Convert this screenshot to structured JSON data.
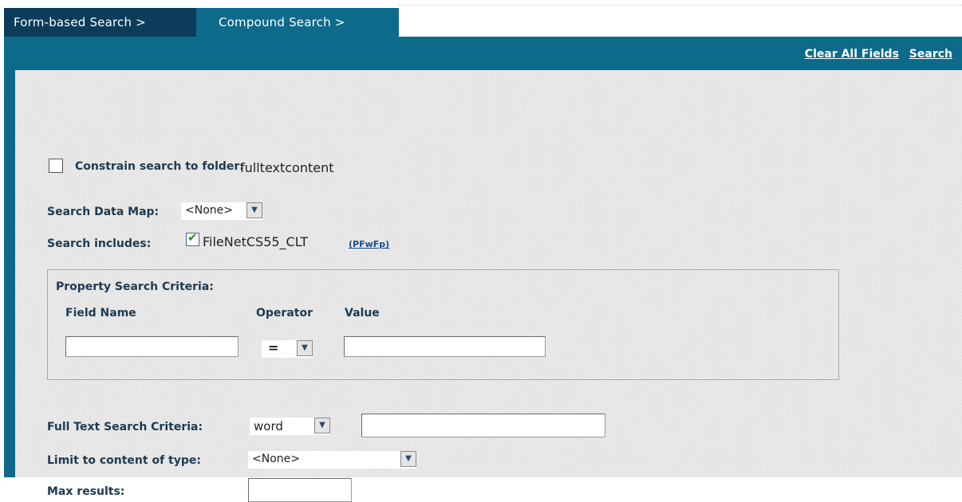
{
  "tabs": {
    "form_based": "Form-based Search >",
    "compound": "Compound Search >"
  },
  "header_links": {
    "clear_all": "Clear All Fields",
    "search": "Search"
  },
  "constrain": {
    "label": "Constrain search to folder:",
    "folder": "fulltextcontent",
    "checked": false
  },
  "data_map": {
    "label": "Search Data Map:",
    "selected": "<None>"
  },
  "includes": {
    "label": "Search includes:",
    "store": "FileNetCS55_CLT",
    "link": "(PFwFp)",
    "checked": true
  },
  "property_criteria": {
    "title": "Property Search Criteria:",
    "col_field": "Field Name",
    "col_operator": "Operator",
    "col_value": "Value",
    "field_value": "",
    "operator": "=",
    "value": ""
  },
  "full_text": {
    "label": "Full Text Search Criteria:",
    "mode": "word",
    "value": ""
  },
  "content_type": {
    "label": "Limit to content of type:",
    "selected": "<None>"
  },
  "max_results": {
    "label": "Max results:",
    "value": ""
  },
  "colors": {
    "tab_dark": "#0b3d5a",
    "tab_active": "#0e6a8a",
    "frame": "#0e6a8a",
    "panel": "#ececec",
    "label_text": "#1d3a52"
  }
}
